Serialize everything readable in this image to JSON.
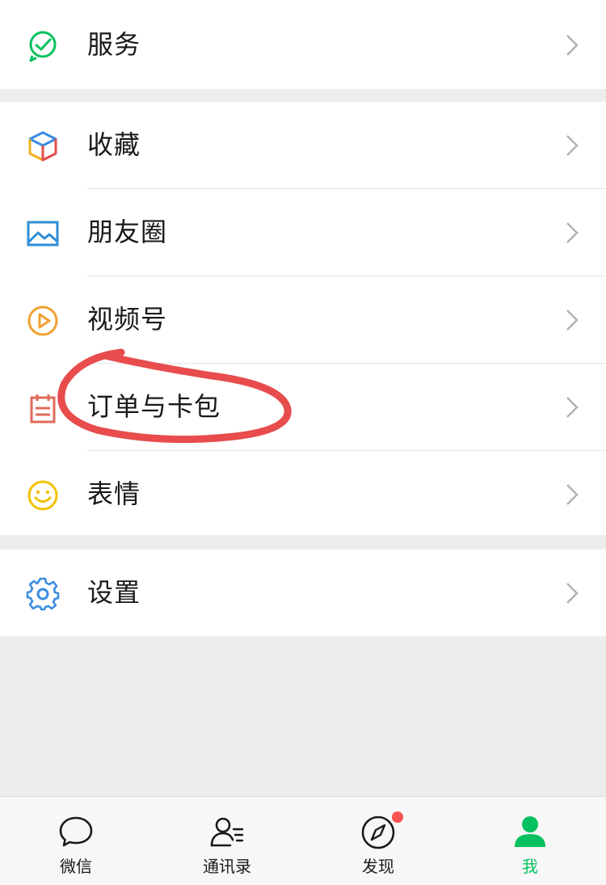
{
  "menu": {
    "services": "服务",
    "favorites": "收藏",
    "moments": "朋友圈",
    "channels": "视频号",
    "orders_cards": "订单与卡包",
    "stickers": "表情",
    "settings": "设置"
  },
  "tabbar": {
    "chats": "微信",
    "contacts": "通讯录",
    "discover": "发现",
    "me": "我",
    "active": "我"
  },
  "icons": {
    "services": "services-check-icon",
    "favorites": "cube-icon",
    "moments": "picture-icon",
    "channels": "play-circle-icon",
    "orders_cards": "calendar-icon",
    "stickers": "smiley-icon",
    "settings": "gear-icon",
    "chevron": "chevron-right-icon"
  },
  "colors": {
    "accent_green": "#07c160",
    "badge_red": "#fa5151",
    "annotation_red": "#e84c4c"
  }
}
